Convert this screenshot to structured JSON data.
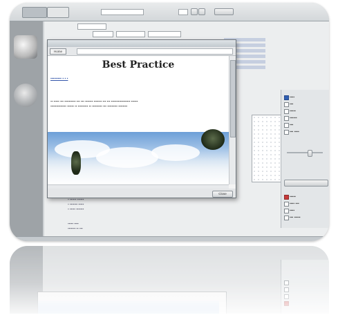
{
  "dialog": {
    "home_label": "Home",
    "close_label": "Close"
  },
  "help": {
    "title": "Best Practice"
  },
  "colors": {
    "card_bg": "#cfd3d6",
    "sky_top": "#6d9fd7",
    "checkbox_red": "#c83a3a",
    "checkbox_blue": "#2f5fb3"
  },
  "icons": {
    "thumbnail_top": "render-thumbnail-icon",
    "thumbnail_bottom": "sphere-thumbnail-icon"
  }
}
